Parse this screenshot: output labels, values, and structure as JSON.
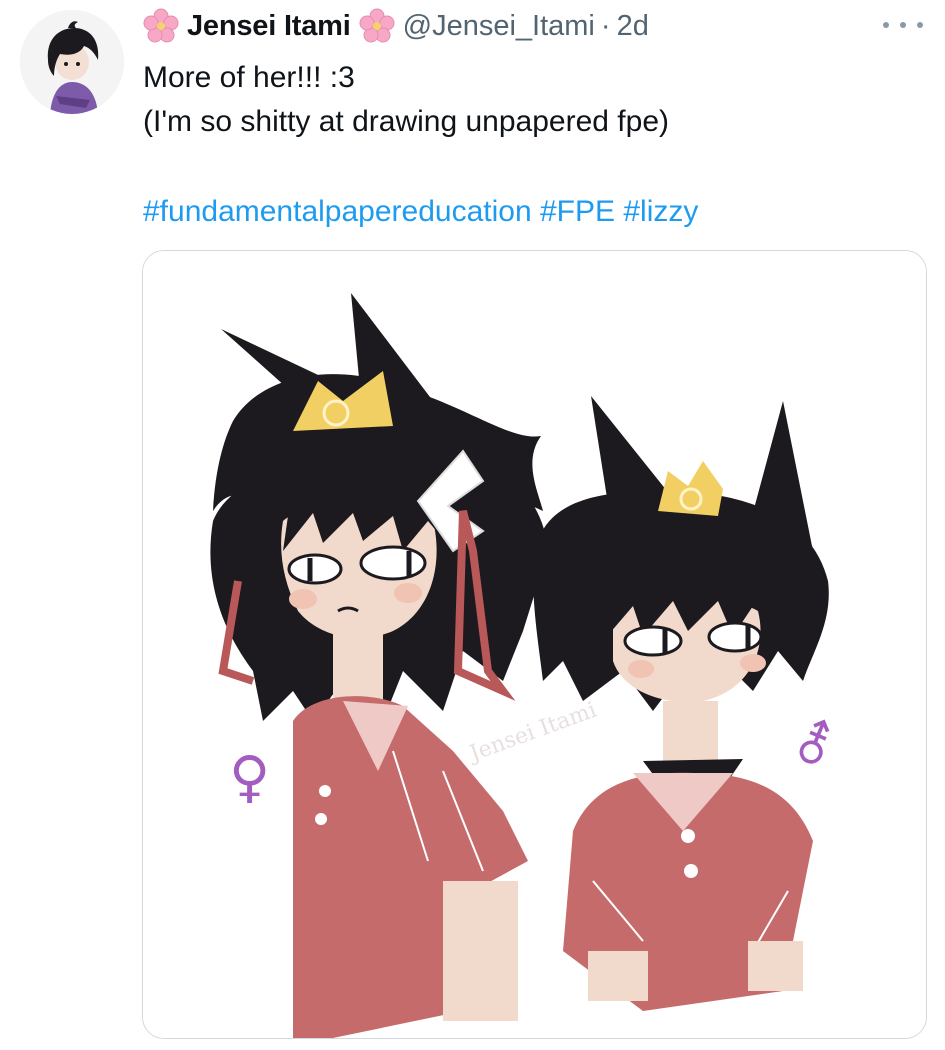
{
  "tweet": {
    "author": {
      "display_name": "Jensei Itami",
      "handle": "@Jensei_Itami",
      "name_emoji_left": "cherry-blossom-icon",
      "name_emoji_right": "cherry-blossom-icon"
    },
    "separator": "·",
    "age": "2d",
    "text_lines": [
      "More of her!!! :3",
      "(I'm so shitty at drawing unpapered fpe)"
    ],
    "hashtags": [
      "#fundamentalpapereducation",
      "#FPE",
      "#lizzy"
    ],
    "more_icon": "more-horizontal-icon"
  },
  "media": {
    "signature_text": "Jensei Itami",
    "left_symbol": "♀",
    "right_symbol": "⚦"
  },
  "colors": {
    "link": "#1d9bf0",
    "secondary_text": "#536471",
    "border": "#cfd9de",
    "hair": "#1c1a1e",
    "shirt": "#c66b6b",
    "crown": "#f2cf63",
    "skin": "#f1d9cc"
  }
}
